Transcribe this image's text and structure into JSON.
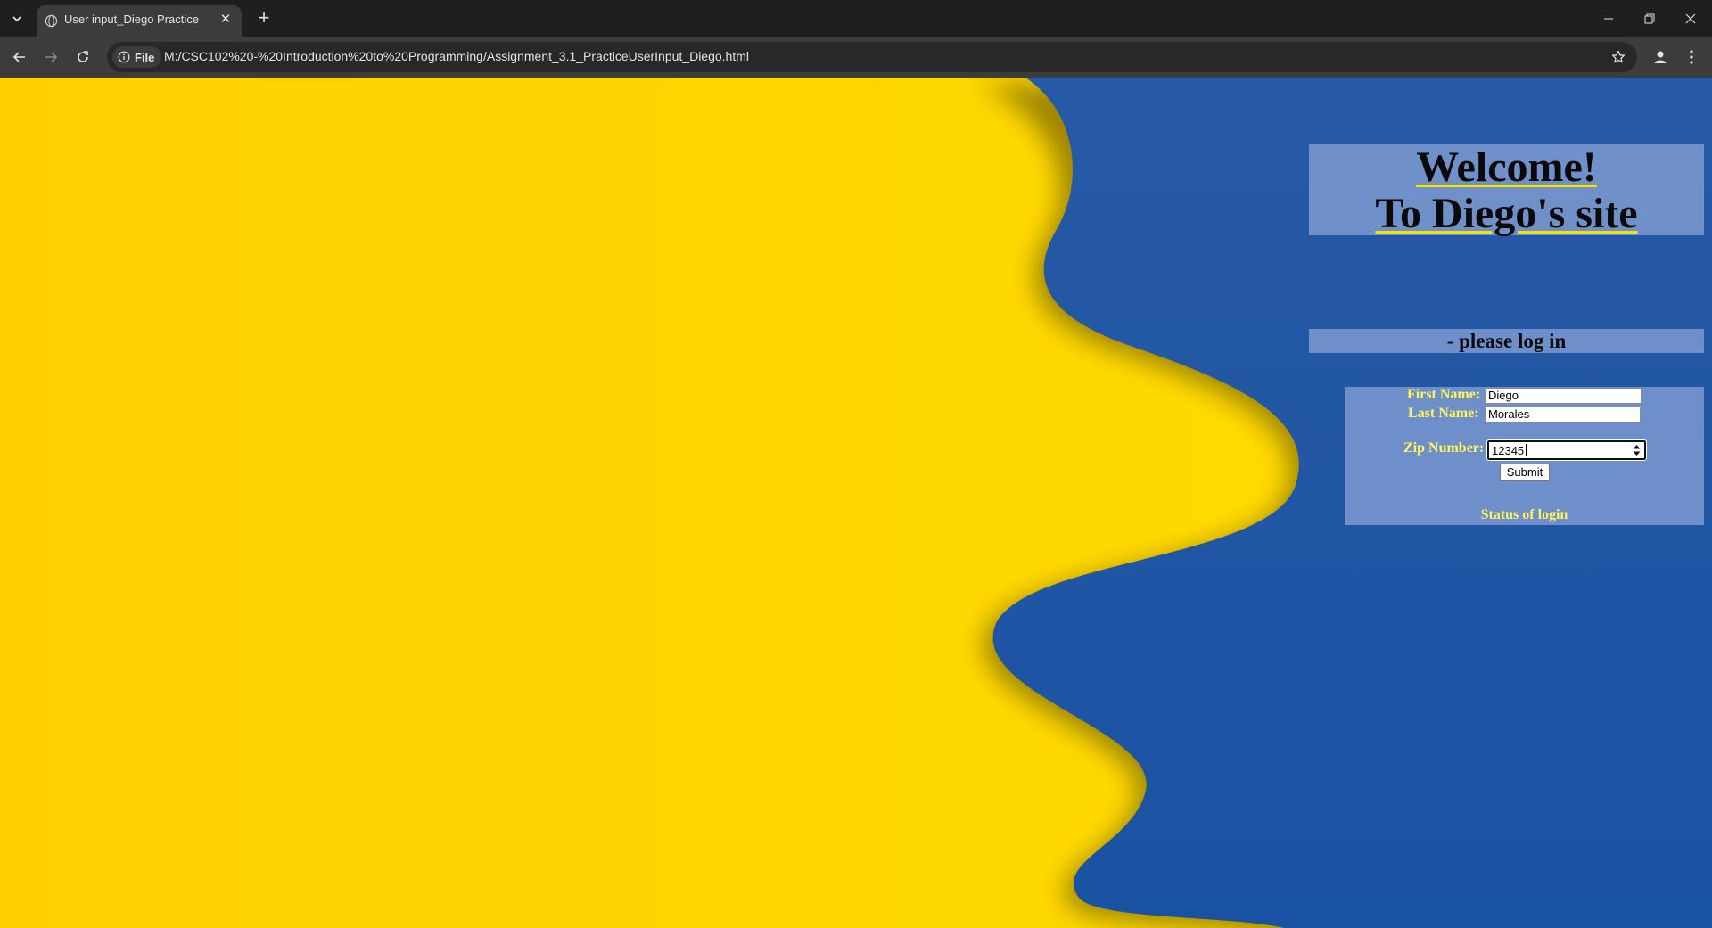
{
  "browser": {
    "tab_title": "User input_Diego Practice",
    "site_chip_label": "File",
    "url": "M:/CSC102%20-%20Introduction%20to%20Programming/Assignment_3.1_PracticeUserInput_Diego.html"
  },
  "page": {
    "welcome_line1": "Welcome!",
    "welcome_line2": "To Diego's site",
    "login_heading": "- please log in",
    "form": {
      "first_name_label": "First Name:",
      "first_name_value": "Diego",
      "last_name_label": "Last Name:",
      "last_name_value": "Morales",
      "zip_label": "Zip Number:",
      "zip_value": "12345",
      "submit_label": "Submit",
      "status_text": "Status of login"
    }
  },
  "colors": {
    "background_yellow": "#ffd400",
    "background_blue": "#1f57a8",
    "panel_tint": "#8ca5d7",
    "form_label_yellow": "#fff45a",
    "heading_underline": "#f2e600"
  }
}
